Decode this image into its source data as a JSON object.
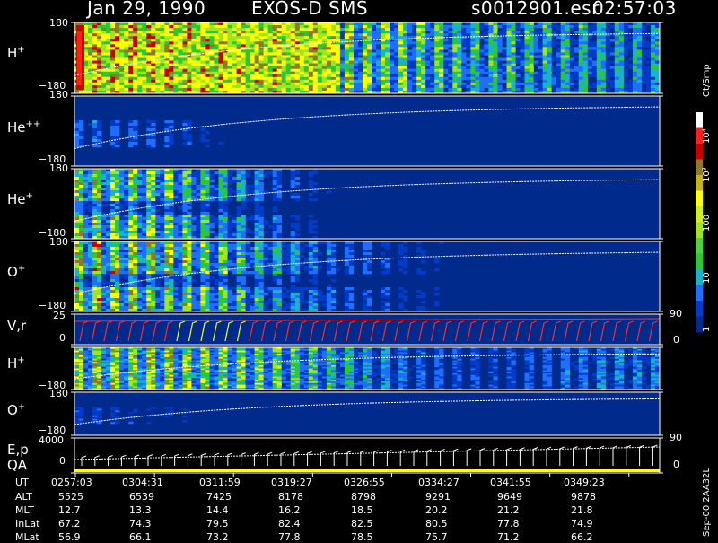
{
  "header": {
    "date": "Jan 29, 1990",
    "instrument": "EXOS-D SMS",
    "file": "s0012901.esr",
    "time": "02:57:03"
  },
  "panels": [
    {
      "name": "H",
      "sup": "+",
      "top": "180",
      "bottom": "−180"
    },
    {
      "name": "He",
      "sup": "++",
      "top": "180",
      "bottom": "−180"
    },
    {
      "name": "He",
      "sup": "+",
      "top": "180",
      "bottom": "−180"
    },
    {
      "name": "O",
      "sup": "+",
      "top": "180",
      "bottom": "−180"
    },
    {
      "name": "V,r",
      "sup": "",
      "top": "25",
      "bottom": "0",
      "right_top": "90",
      "right_bottom": "0"
    },
    {
      "name": "H",
      "sup": "+",
      "top": "180",
      "bottom": "−180"
    },
    {
      "name": "O",
      "sup": "+",
      "top": "180",
      "bottom": "−180",
      "right_bottom": "90"
    },
    {
      "name": "E,p",
      "name2": "QA",
      "sup": "",
      "top": "4000",
      "bottom": "0",
      "right_bottom": "0"
    }
  ],
  "colorbar": {
    "unit": "Ct/Smp",
    "labels": [
      "10⁴",
      "10³",
      "100",
      "10",
      "1"
    ]
  },
  "footer_label": "Sep-00  2AA32L",
  "orbit": {
    "row_labels": [
      "UT",
      "ALT",
      "MLT",
      "InLat",
      "MLat"
    ],
    "columns": [
      [
        "0257:03",
        "5525",
        "12.7",
        "67.2",
        "56.9"
      ],
      [
        "0304:31",
        "6539",
        "13.3",
        "74.3",
        "66.1"
      ],
      [
        "0311:59",
        "7425",
        "14.4",
        "79.5",
        "73.2"
      ],
      [
        "0319:27",
        "8178",
        "16.2",
        "82.4",
        "77.8"
      ],
      [
        "0326:55",
        "8798",
        "18.5",
        "82.5",
        "78.5"
      ],
      [
        "0334:27",
        "9291",
        "20.2",
        "80.5",
        "75.7"
      ],
      [
        "0341:55",
        "9649",
        "21.2",
        "77.8",
        "71.2"
      ],
      [
        "0349:23",
        "9878",
        "21.8",
        "74.9",
        "66.2"
      ]
    ]
  },
  "chart_data": {
    "type": "heatmap",
    "x": [
      "0257:03",
      "0304:31",
      "0311:59",
      "0319:27",
      "0326:55",
      "0334:27",
      "0341:55",
      "0349:23"
    ],
    "y_range": [
      -180,
      180
    ],
    "color_scale": "log",
    "color_range": [
      1,
      10000
    ],
    "colors": [
      "#002a8c",
      "#003cc8",
      "#1e6eff",
      "#16b4c8",
      "#2cc832",
      "#9ee61e",
      "#ffff00",
      "#8c7a28",
      "#c80000",
      "#ff1e1e",
      "#ffffff"
    ],
    "series": [
      {
        "name": "H⁺",
        "activity": [
          1.0,
          0.95,
          0.9,
          0.85,
          0.7,
          0.6,
          0.55,
          0.45
        ]
      },
      {
        "name": "He⁺⁺",
        "activity": [
          0.35,
          0.3,
          0.1,
          0.05,
          0.05,
          0.02,
          0.02,
          0.02
        ]
      },
      {
        "name": "He⁺",
        "activity": [
          0.85,
          0.75,
          0.45,
          0.15,
          0.1,
          0.05,
          0.05,
          0.05
        ]
      },
      {
        "name": "O⁺",
        "activity": [
          0.9,
          0.85,
          0.6,
          0.35,
          0.2,
          0.1,
          0.1,
          0.1
        ]
      },
      {
        "name": "H⁺",
        "activity": [
          0.85,
          0.85,
          0.75,
          0.6,
          0.35,
          0.25,
          0.35,
          0.4
        ]
      },
      {
        "name": "O⁺",
        "activity": [
          0.25,
          0.2,
          0.05,
          0.05,
          0.05,
          0.05,
          0.05,
          0.05
        ]
      }
    ]
  }
}
